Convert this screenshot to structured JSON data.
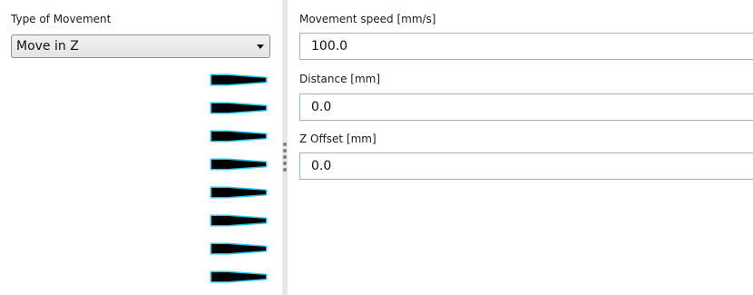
{
  "movement": {
    "type_label": "Type of Movement",
    "type_selected": "Move in Z"
  },
  "fields": {
    "speed_label": "Movement speed [mm/s]",
    "speed_value": "100.0",
    "distance_label": "Distance [mm]",
    "distance_value": "0.0",
    "z_offset_label": "Z Offset [mm]",
    "z_offset_value": "0.0"
  },
  "icons": {
    "nozzle_icon": "nozzle-icon",
    "nozzle_count": 8,
    "nozzle_fill": "#000000",
    "nozzle_glow": "#1ec8f0"
  },
  "colors": {
    "input_border": "#a3aebd",
    "splitter": "#e7e7e7"
  }
}
